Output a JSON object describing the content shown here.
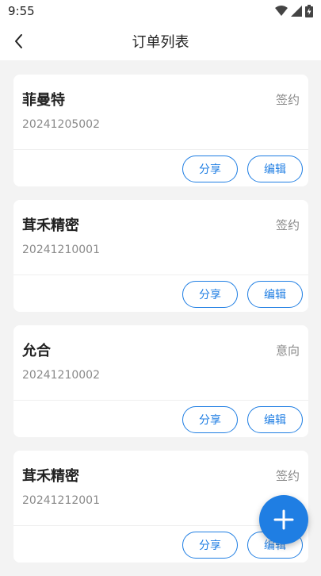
{
  "status_bar": {
    "time": "9:55"
  },
  "header": {
    "title": "订单列表",
    "back_icon": "chevron-left-icon"
  },
  "orders": [
    {
      "name": "菲曼特",
      "status": "签约",
      "order_no": "20241205002",
      "share_label": "分享",
      "edit_label": "编辑"
    },
    {
      "name": "茸禾精密",
      "status": "签约",
      "order_no": "20241210001",
      "share_label": "分享",
      "edit_label": "编辑"
    },
    {
      "name": "允合",
      "status": "意向",
      "order_no": "20241210002",
      "share_label": "分享",
      "edit_label": "编辑"
    },
    {
      "name": "茸禾精密",
      "status": "签约",
      "order_no": "20241212001",
      "share_label": "分享",
      "edit_label": "编辑"
    }
  ],
  "fab": {
    "icon": "plus-icon"
  },
  "colors": {
    "accent": "#1f7ee3",
    "background": "#f3f3f3",
    "muted": "#8a8a8a"
  }
}
